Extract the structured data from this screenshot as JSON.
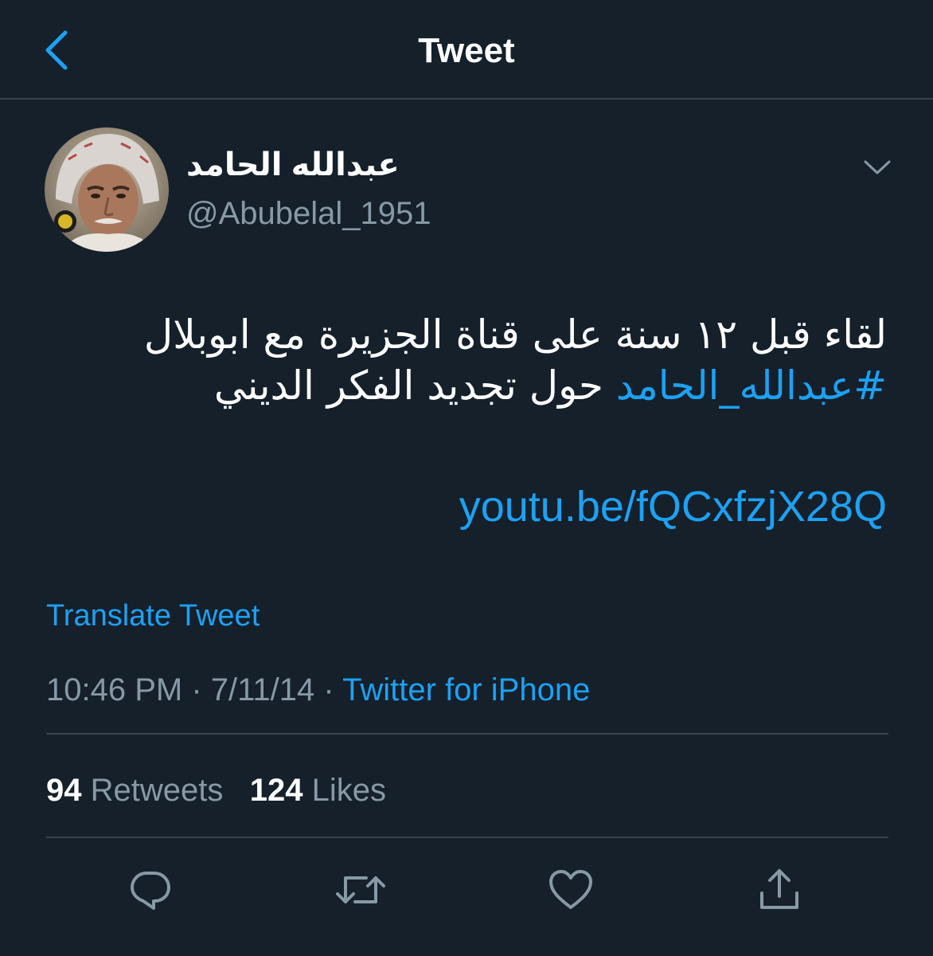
{
  "header": {
    "title": "Tweet",
    "back_icon": "chevron-left-icon"
  },
  "colors": {
    "background": "#15202b",
    "accent": "#1da1f2",
    "muted": "#8899a6",
    "divider": "#38444d",
    "text": "#ffffff"
  },
  "author": {
    "display_name": "عبدالله الحامد",
    "handle": "@Abubelal_1951",
    "avatar_icon": "profile-photo",
    "menu_icon": "chevron-down-icon"
  },
  "tweet": {
    "line1": "لقاء قبل ١٢ سنة على قناة الجزيرة مع ابوبلال",
    "hashtag": "#عبدالله_الحامد",
    "line2_rest": " حول تجديد الفكر الديني",
    "link": "youtu.be/fQCxfzjX28Q",
    "translate_label": "Translate Tweet"
  },
  "meta": {
    "time": "10:46 PM",
    "separator": " · ",
    "date": "7/11/14",
    "source": "Twitter for iPhone"
  },
  "stats": {
    "retweets_count": "94",
    "retweets_label": "Retweets",
    "likes_count": "124",
    "likes_label": "Likes"
  },
  "actions": {
    "reply_icon": "reply-icon",
    "retweet_icon": "retweet-icon",
    "like_icon": "heart-icon",
    "share_icon": "share-icon"
  }
}
